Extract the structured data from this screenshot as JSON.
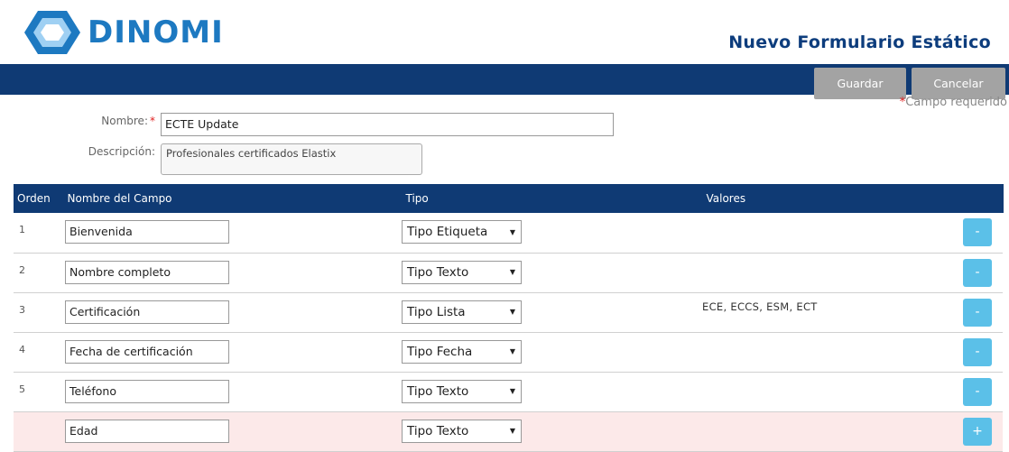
{
  "brand": {
    "logo_text": "DINOMI",
    "color": "#1d79c1"
  },
  "page_title": "Nuevo Formulario Estático",
  "toolbar": {
    "save_label": "Guardar",
    "cancel_label": "Cancelar"
  },
  "required_note": {
    "star": "*",
    "text": "Campo requerido"
  },
  "form": {
    "name_label": "Nombre:",
    "name_required_star": "*",
    "name_value": "ECTE Update",
    "description_label": "Descripción:",
    "description_value": "Profesionales certificados Elastix"
  },
  "table": {
    "headers": {
      "order": "Orden",
      "name": "Nombre del Campo",
      "type": "Tipo",
      "values": "Valores"
    },
    "rows": [
      {
        "order": "1",
        "name": "Bienvenida",
        "type": "Tipo Etiqueta",
        "values": "",
        "action": "-"
      },
      {
        "order": "2",
        "name": "Nombre completo",
        "type": "Tipo Texto",
        "values": "",
        "action": "-"
      },
      {
        "order": "3",
        "name": "Certificación",
        "type": "Tipo Lista",
        "values": "ECE, ECCS, ESM, ECT",
        "action": "-"
      },
      {
        "order": "4",
        "name": "Fecha de certificación",
        "type": "Tipo Fecha",
        "values": "",
        "action": "-"
      },
      {
        "order": "5",
        "name": "Teléfono",
        "type": "Tipo Texto",
        "values": "",
        "action": "-"
      }
    ],
    "new_row": {
      "name": "Edad",
      "type": "Tipo Texto",
      "action": "+"
    }
  },
  "colors": {
    "nav_bar": "#0f3a74",
    "button_gray": "#a3a3a3",
    "row_button": "#5bc0e8",
    "new_row_bg": "#fce9e9",
    "required_red": "#e01f1f"
  }
}
